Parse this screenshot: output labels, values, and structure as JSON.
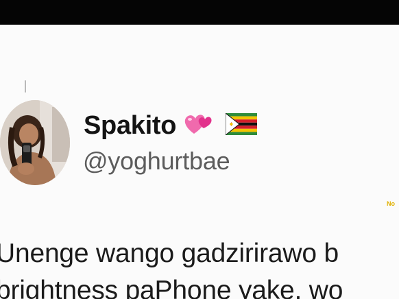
{
  "profile": {
    "display_name": "Spakito",
    "handle": "@yoghurtbae",
    "name_emojis": [
      "two-hearts-icon",
      "zimbabwe-flag-icon"
    ],
    "avatar": "profile-photo"
  },
  "side_mark": "No",
  "tweet": {
    "lines": [
      "Unenge wango gadzirirawo b",
      "brightness paPhone yake, wo"
    ]
  },
  "colors": {
    "top_bar": "#050505",
    "background": "#fbfbfb",
    "name": "#141414",
    "handle": "#5c5c5c",
    "hearts": "#e94ba0",
    "flag_green": "#2e8b3a",
    "flag_yellow": "#f2c500",
    "flag_red": "#d4202a",
    "flag_black": "#111111"
  }
}
